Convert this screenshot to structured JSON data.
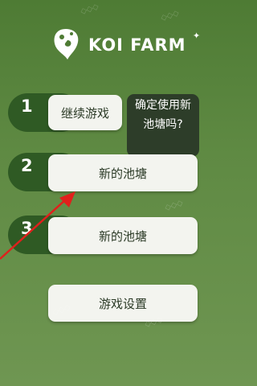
{
  "logo": {
    "text": "KOI FARM",
    "icon": "koi-fish-icon"
  },
  "slots": [
    {
      "number": "1",
      "button_label": "继续游戏"
    },
    {
      "number": "2",
      "button_label": "新的池塘"
    },
    {
      "number": "3",
      "button_label": "新的池塘"
    }
  ],
  "confirm_tooltip": {
    "text": "确定使用新池塘吗?"
  },
  "settings_button": {
    "label": "游戏设置"
  },
  "colors": {
    "background": "#5f8a43",
    "slot_pill": "#2f5a24",
    "button": "#f3f4ef",
    "tooltip": "#2d3d29",
    "arrow": "#e0201c"
  }
}
